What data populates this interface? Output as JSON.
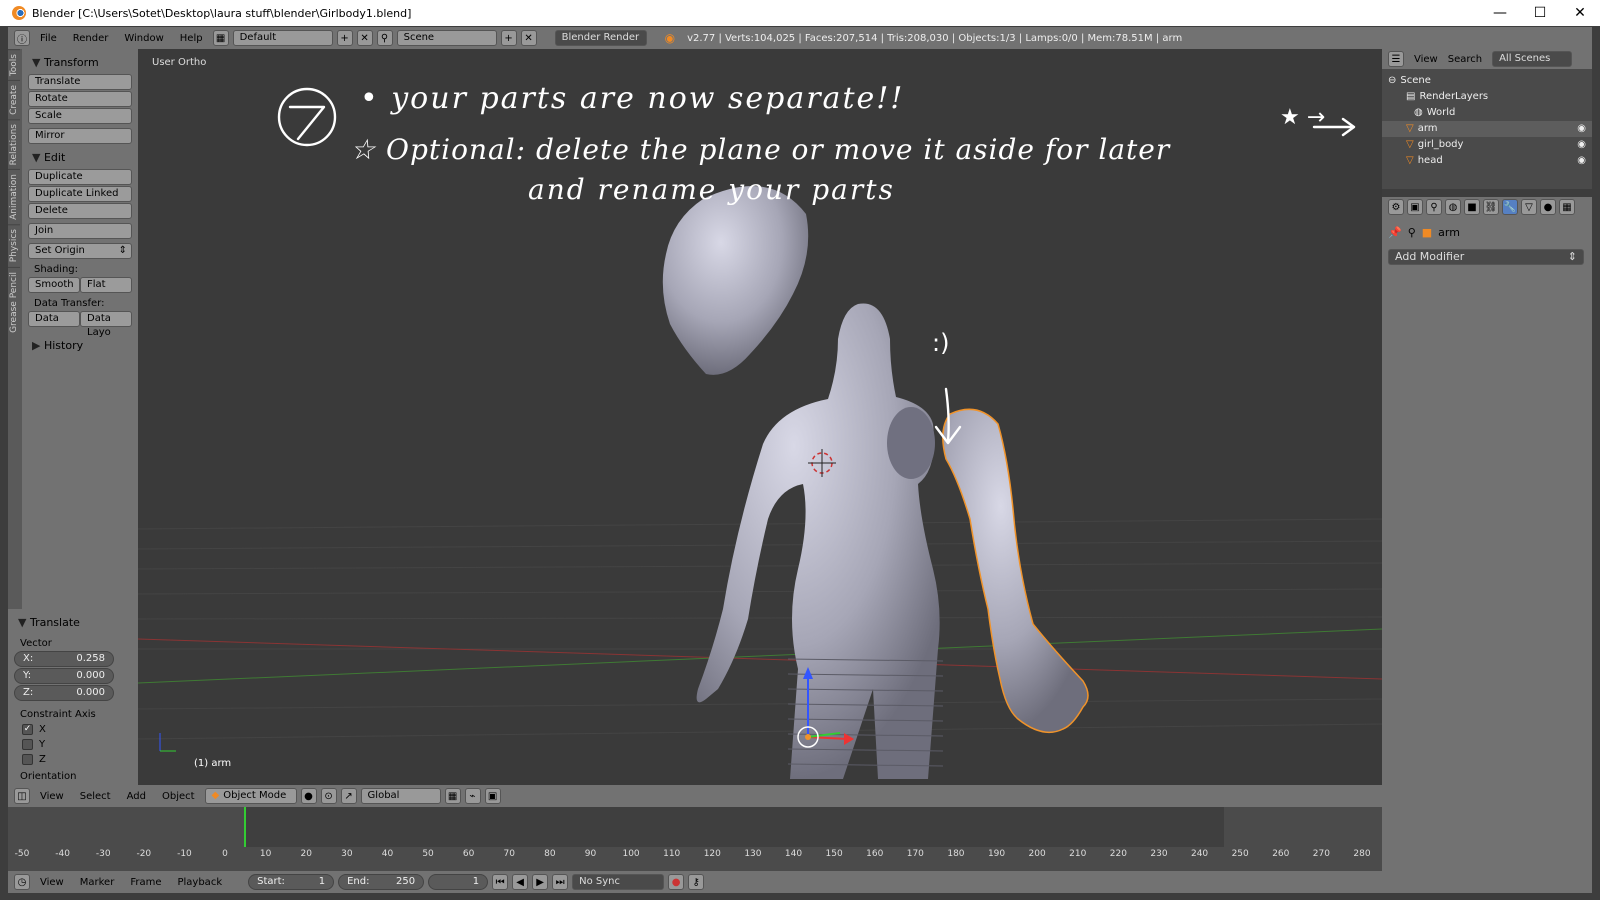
{
  "window": {
    "title": "Blender [C:\\Users\\Sotet\\Desktop\\laura stuff\\blender\\Girlbody1.blend]",
    "minimize": "—",
    "maximize": "☐",
    "close": "✕"
  },
  "header": {
    "menus": [
      "File",
      "Render",
      "Window",
      "Help"
    ],
    "layout": "Default",
    "scene": "Scene",
    "engine": "Blender Render",
    "stats": "v2.77 | Verts:104,025 | Faces:207,514 | Tris:208,030 | Objects:1/3 | Lamps:0/0 | Mem:78.51M | arm"
  },
  "tabs": [
    "Tools",
    "Create",
    "Relations",
    "Animation",
    "Physics",
    "Grease Pencil"
  ],
  "tools": {
    "transform_title": "Transform",
    "translate": "Translate",
    "rotate": "Rotate",
    "scale": "Scale",
    "mirror": "Mirror",
    "edit_title": "Edit",
    "duplicate": "Duplicate",
    "duplicate_linked": "Duplicate Linked",
    "delete": "Delete",
    "join": "Join",
    "set_origin": "Set Origin",
    "shading_label": "Shading:",
    "smooth": "Smooth",
    "flat": "Flat",
    "data_transfer_label": "Data Transfer:",
    "data": "Data",
    "data_layo": "Data Layo",
    "history_title": "History"
  },
  "operator": {
    "title": "Translate",
    "vector_label": "Vector",
    "x_label": "X:",
    "x": "0.258",
    "y_label": "Y:",
    "y": "0.000",
    "z_label": "Z:",
    "z": "0.000",
    "constraint_label": "Constraint Axis",
    "cx": "X",
    "cy": "Y",
    "cz": "Z",
    "orientation": "Orientation"
  },
  "viewport": {
    "view_label": "User Ortho",
    "object_label": "(1) arm"
  },
  "annotation": {
    "step": "7",
    "line1": "• your parts are now separate!!",
    "line2": "☆ Optional: delete the plane or move it aside for later",
    "line3": "and rename your parts",
    "smile": ":)",
    "corner": "★ →"
  },
  "viewheader": {
    "menus": [
      "View",
      "Select",
      "Add",
      "Object"
    ],
    "mode": "Object Mode",
    "orientation": "Global"
  },
  "timeline": {
    "ticks": [
      "-50",
      "-40",
      "-30",
      "-20",
      "-10",
      "0",
      "10",
      "20",
      "30",
      "40",
      "50",
      "60",
      "70",
      "80",
      "90",
      "100",
      "110",
      "120",
      "130",
      "140",
      "150",
      "160",
      "170",
      "180",
      "190",
      "200",
      "210",
      "220",
      "230",
      "240",
      "250",
      "260",
      "270",
      "280"
    ]
  },
  "timelineheader": {
    "menus": [
      "View",
      "Marker",
      "Frame",
      "Playback"
    ],
    "start_label": "Start:",
    "start": "1",
    "end_label": "End:",
    "end": "250",
    "current": "1",
    "sync": "No Sync"
  },
  "outliner": {
    "view": "View",
    "search": "Search",
    "scope": "All Scenes",
    "scene": "Scene",
    "renderlayers": "RenderLayers",
    "world": "World",
    "items": [
      "arm",
      "girl_body",
      "head"
    ]
  },
  "properties": {
    "object": "arm",
    "add_modifier": "Add Modifier"
  }
}
